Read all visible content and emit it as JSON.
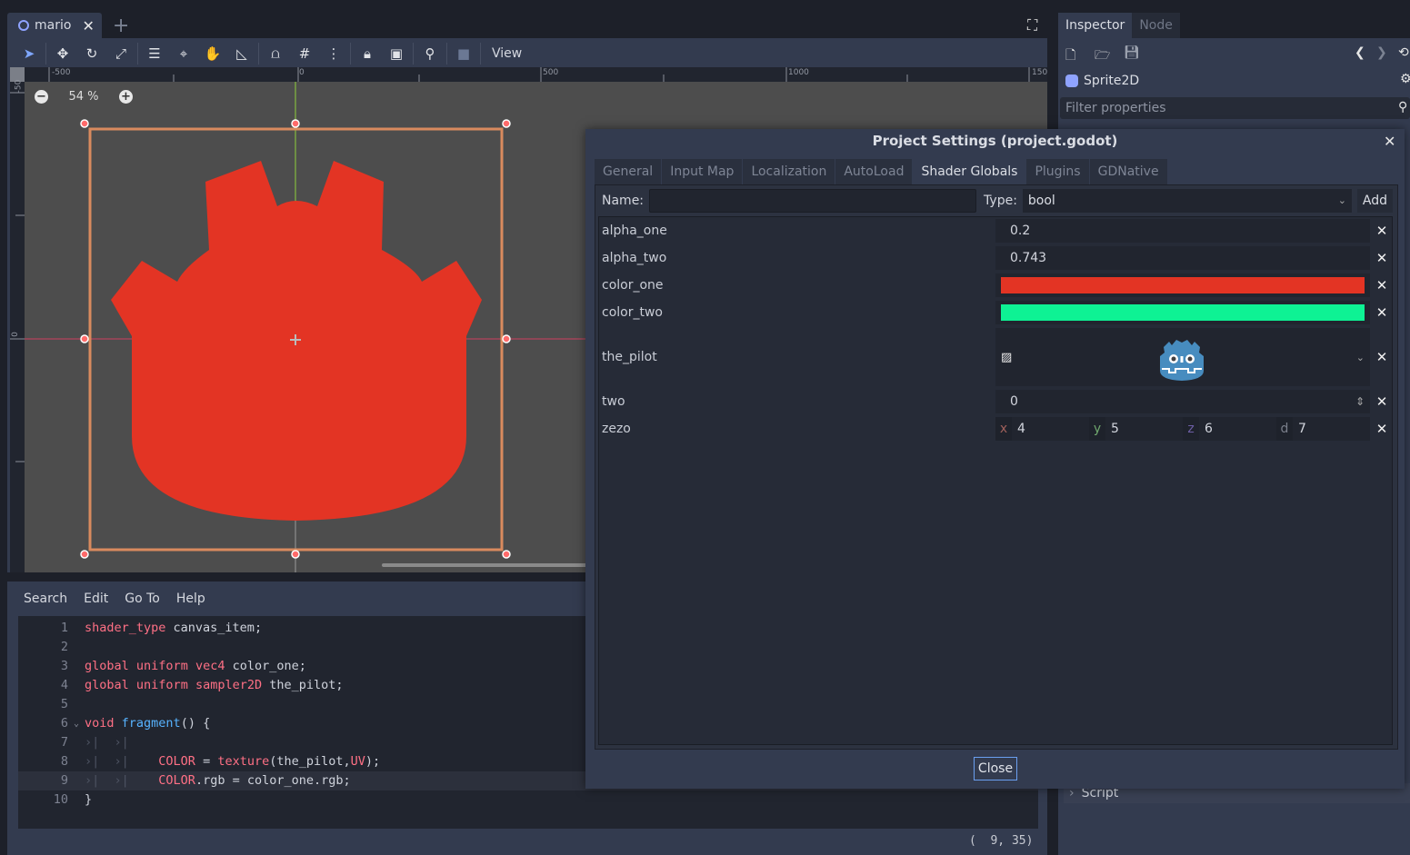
{
  "scene_tabs": [
    {
      "label": "mario"
    }
  ],
  "toolbar": {
    "tools": [
      "select-tool",
      "move-tool",
      "rotate-tool",
      "scale-tool",
      "list-select-tool",
      "pivot-tool",
      "pan-tool",
      "ruler-tool",
      "smart-snap",
      "grid-snap",
      "snap-options",
      "lock",
      "group",
      "skeleton",
      "camera-override"
    ],
    "view_label": "View"
  },
  "rulers": {
    "top": [
      "-500",
      "0",
      "500",
      "1000",
      "150"
    ],
    "left": [
      "-50",
      "0"
    ]
  },
  "viewport": {
    "zoom_label": "54 %",
    "sprite_color": "#e33424",
    "selection_color": "#d98a5e"
  },
  "editor": {
    "menu": [
      "Search",
      "Edit",
      "Go To",
      "Help"
    ],
    "lines": [
      {
        "n": "1",
        "tokens": [
          [
            "kw",
            "shader_type"
          ],
          [
            "code",
            " canvas_item;"
          ]
        ]
      },
      {
        "n": "2",
        "tokens": []
      },
      {
        "n": "3",
        "tokens": [
          [
            "kw",
            "global"
          ],
          [
            "code",
            " "
          ],
          [
            "kw",
            "uniform"
          ],
          [
            "code",
            " "
          ],
          [
            "kw",
            "vec4"
          ],
          [
            "code",
            " color_one;"
          ]
        ]
      },
      {
        "n": "4",
        "tokens": [
          [
            "kw",
            "global"
          ],
          [
            "code",
            " "
          ],
          [
            "kw",
            "uniform"
          ],
          [
            "code",
            " "
          ],
          [
            "kw",
            "sampler2D"
          ],
          [
            "code",
            " the_pilot;"
          ]
        ]
      },
      {
        "n": "5",
        "tokens": []
      },
      {
        "n": "6",
        "fold": true,
        "tokens": [
          [
            "kw",
            "void"
          ],
          [
            "code",
            " "
          ],
          [
            "fn",
            "fragment"
          ],
          [
            "code",
            "() {"
          ]
        ]
      },
      {
        "n": "7",
        "tabs": 2,
        "tokens": []
      },
      {
        "n": "8",
        "tabs": 2,
        "tokens": [
          [
            "code",
            "  "
          ],
          [
            "kw",
            "COLOR"
          ],
          [
            "code",
            " = "
          ],
          [
            "kw",
            "texture"
          ],
          [
            "code",
            "(the_pilot,"
          ],
          [
            "kw",
            "UV"
          ],
          [
            "code",
            ");"
          ]
        ]
      },
      {
        "n": "9",
        "tabs": 2,
        "current": true,
        "tokens": [
          [
            "code",
            "  "
          ],
          [
            "kw",
            "COLOR"
          ],
          [
            "code",
            ".rgb = color_one.rgb;"
          ]
        ]
      },
      {
        "n": "10",
        "tokens": [
          [
            "code",
            "}"
          ]
        ]
      }
    ],
    "cursor_position": "(  9, 35)"
  },
  "inspector": {
    "tabs": [
      "Inspector",
      "Node"
    ],
    "node_name": "Sprite2D",
    "filter_placeholder": "Filter properties",
    "script_section": "Script"
  },
  "dialog": {
    "title": "Project Settings (project.godot)",
    "tabs": [
      "General",
      "Input Map",
      "Localization",
      "AutoLoad",
      "Shader Globals",
      "Plugins",
      "GDNative"
    ],
    "active_tab": "Shader Globals",
    "name_label": "Name:",
    "name_value": "",
    "type_label": "Type:",
    "type_value": "bool",
    "add_label": "Add",
    "globals": [
      {
        "name": "alpha_one",
        "kind": "number",
        "value": "0.2"
      },
      {
        "name": "alpha_two",
        "kind": "number",
        "value": "0.743"
      },
      {
        "name": "color_one",
        "kind": "color",
        "value": "#e33424"
      },
      {
        "name": "color_two",
        "kind": "color",
        "value": "#0ef294"
      },
      {
        "name": "the_pilot",
        "kind": "texture",
        "value": "godot-icon"
      },
      {
        "name": "two",
        "kind": "spin",
        "value": "0"
      },
      {
        "name": "zezo",
        "kind": "vec4",
        "x": "4",
        "y": "5",
        "z": "6",
        "d": "7"
      }
    ],
    "close_label": "Close"
  }
}
